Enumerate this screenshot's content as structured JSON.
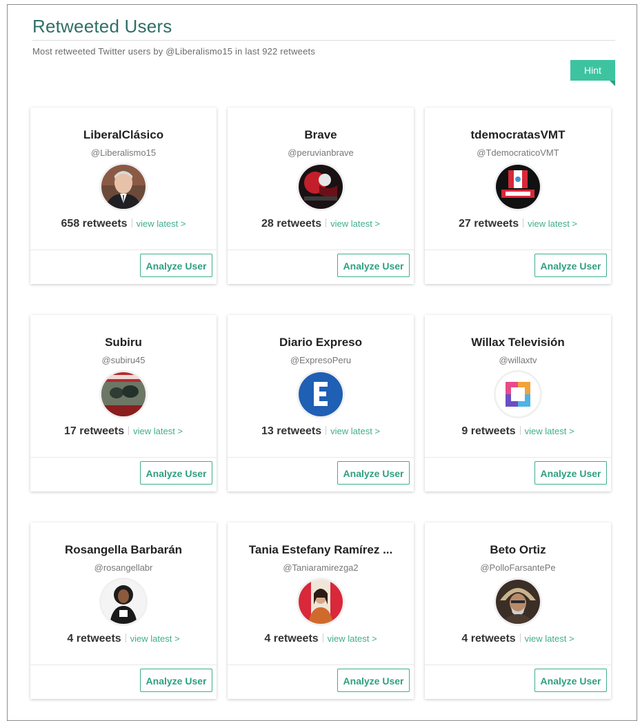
{
  "header": {
    "title": "Retweeted Users",
    "subtitle": "Most retweeted Twitter users by @Liberalismo15 in last 922 retweets",
    "hint_label": "Hint"
  },
  "colors": {
    "accent": "#3ec3a0",
    "title": "#2f6f66",
    "link": "#3eae8e"
  },
  "users": [
    {
      "name": "LiberalClásico",
      "handle": "@Liberalismo15",
      "retweets": "658 retweets",
      "view_latest": "view latest >",
      "analyze": "Analyze User",
      "avatar_icon": "portrait-man-suit-avatar"
    },
    {
      "name": "Brave",
      "handle": "@peruvianbrave",
      "retweets": "28 retweets",
      "view_latest": "view latest >",
      "analyze": "Analyze User",
      "avatar_icon": "dark-red-graphic-avatar"
    },
    {
      "name": "tdemocratasVMT",
      "handle": "@TdemocraticoVMT",
      "retweets": "27 retweets",
      "view_latest": "view latest >",
      "analyze": "Analyze User",
      "avatar_icon": "peru-flag-logo-avatar"
    },
    {
      "name": "Subiru",
      "handle": "@subiru45",
      "retweets": "17 retweets",
      "view_latest": "view latest >",
      "analyze": "Analyze User",
      "avatar_icon": "group-photo-avatar"
    },
    {
      "name": "Diario Expreso",
      "handle": "@ExpresoPeru",
      "retweets": "13 retweets",
      "view_latest": "view latest >",
      "analyze": "Analyze User",
      "avatar_icon": "expreso-e-logo-avatar"
    },
    {
      "name": "Willax Televisión",
      "handle": "@willaxtv",
      "retweets": "9 retweets",
      "view_latest": "view latest >",
      "analyze": "Analyze User",
      "avatar_icon": "willax-square-logo-avatar"
    },
    {
      "name": "Rosangella Barbarán",
      "handle": "@rosangellabr",
      "retweets": "4 retweets",
      "view_latest": "view latest >",
      "analyze": "Analyze User",
      "avatar_icon": "woman-portrait-avatar"
    },
    {
      "name": "Tania Estefany Ramírez ...",
      "handle": "@Taniaramirezga2",
      "retweets": "4 retweets",
      "view_latest": "view latest >",
      "analyze": "Analyze User",
      "avatar_icon": "woman-flag-portrait-avatar"
    },
    {
      "name": "Beto Ortiz",
      "handle": "@PolloFarsantePe",
      "retweets": "4 retweets",
      "view_latest": "view latest >",
      "analyze": "Analyze User",
      "avatar_icon": "man-feather-headdress-avatar"
    }
  ]
}
